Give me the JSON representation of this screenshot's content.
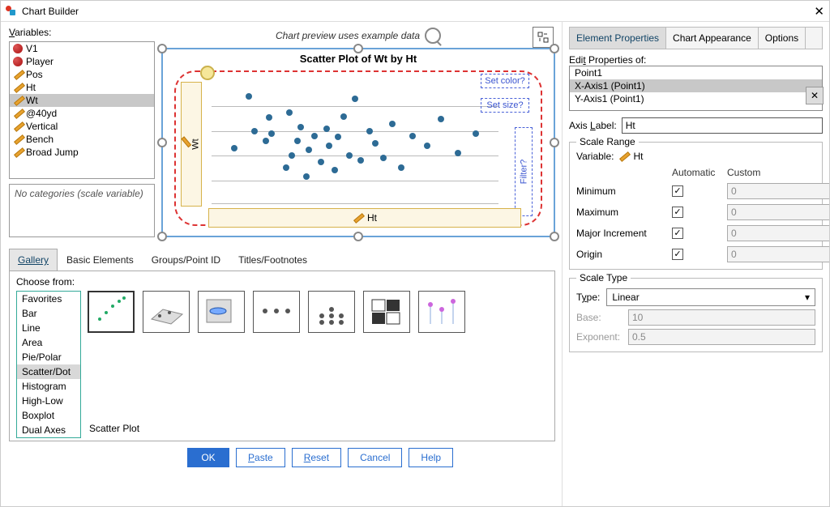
{
  "window": {
    "title": "Chart Builder"
  },
  "variables_label": "Variables:",
  "variables": [
    "V1",
    "Player",
    "Pos",
    "Ht",
    "Wt",
    "@40yd",
    "Vertical",
    "Bench",
    "Broad Jump"
  ],
  "variables_selected": "Wt",
  "variable_types": {
    "V1": "nominal",
    "Player": "nominal",
    "Pos": "scale",
    "Ht": "scale",
    "Wt": "scale",
    "@40yd": "scale",
    "Vertical": "scale",
    "Bench": "scale",
    "Broad Jump": "scale"
  },
  "no_categories_text": "No categories (scale variable)",
  "preview_label": "Chart preview uses example data",
  "chart_title": "Scatter Plot of Wt by Ht",
  "dropzones": {
    "color": "Set color?",
    "size": "Set size?",
    "filter": "Filter?"
  },
  "y_axis_var": "Wt",
  "x_axis_var": "Ht",
  "mid_tabs": [
    "Gallery",
    "Basic Elements",
    "Groups/Point ID",
    "Titles/Footnotes"
  ],
  "mid_active_tab": "Gallery",
  "choose_label": "Choose from:",
  "choose_list": [
    "Favorites",
    "Bar",
    "Line",
    "Area",
    "Pie/Polar",
    "Scatter/Dot",
    "Histogram",
    "High-Low",
    "Boxplot",
    "Dual Axes"
  ],
  "choose_selected": "Scatter/Dot",
  "thumbnail_caption": "Scatter Plot",
  "buttons": {
    "ok": "OK",
    "paste": "Paste",
    "reset": "Reset",
    "cancel": "Cancel",
    "help": "Help"
  },
  "right_tabs": [
    "Element Properties",
    "Chart Appearance",
    "Options"
  ],
  "right_active_tab": "Element Properties",
  "edit_properties_label": "Edit Properties of:",
  "property_items": [
    "Point1",
    "X-Axis1 (Point1)",
    "Y-Axis1 (Point1)"
  ],
  "property_selected": "X-Axis1 (Point1)",
  "axis_label_lbl": "Axis Label:",
  "axis_label_value": "Ht",
  "scale_range": {
    "legend": "Scale Range",
    "variable_lbl": "Variable:",
    "variable_value": "Ht",
    "hdr_auto": "Automatic",
    "hdr_custom": "Custom",
    "rows": [
      {
        "label": "Minimum",
        "auto": true,
        "custom": "0"
      },
      {
        "label": "Maximum",
        "auto": true,
        "custom": "0"
      },
      {
        "label": "Major Increment",
        "auto": true,
        "custom": "0"
      },
      {
        "label": "Origin",
        "auto": true,
        "custom": "0"
      }
    ]
  },
  "scale_type": {
    "legend": "Scale Type",
    "type_lbl": "Type:",
    "type_value": "Linear",
    "base_lbl": "Base:",
    "base_value": "10",
    "exp_lbl": "Exponent:",
    "exp_value": "0.5"
  },
  "chart_data": {
    "type": "scatter",
    "title": "Scatter Plot of Wt by Ht",
    "xlabel": "Ht",
    "ylabel": "Wt",
    "x": [
      0.08,
      0.13,
      0.15,
      0.19,
      0.2,
      0.21,
      0.26,
      0.27,
      0.28,
      0.3,
      0.31,
      0.33,
      0.34,
      0.36,
      0.38,
      0.4,
      0.41,
      0.43,
      0.44,
      0.46,
      0.48,
      0.5,
      0.52,
      0.55,
      0.57,
      0.6,
      0.63,
      0.66,
      0.7,
      0.75,
      0.8,
      0.86,
      0.92
    ],
    "y": [
      0.46,
      0.88,
      0.6,
      0.52,
      0.71,
      0.58,
      0.3,
      0.75,
      0.4,
      0.52,
      0.63,
      0.23,
      0.45,
      0.56,
      0.35,
      0.62,
      0.48,
      0.28,
      0.55,
      0.72,
      0.4,
      0.86,
      0.36,
      0.6,
      0.5,
      0.38,
      0.66,
      0.3,
      0.56,
      0.48,
      0.7,
      0.42,
      0.58
    ],
    "note": "x,y are example-data fractions of plot width/height (0..1); axes show no numeric ticks in screenshot"
  }
}
